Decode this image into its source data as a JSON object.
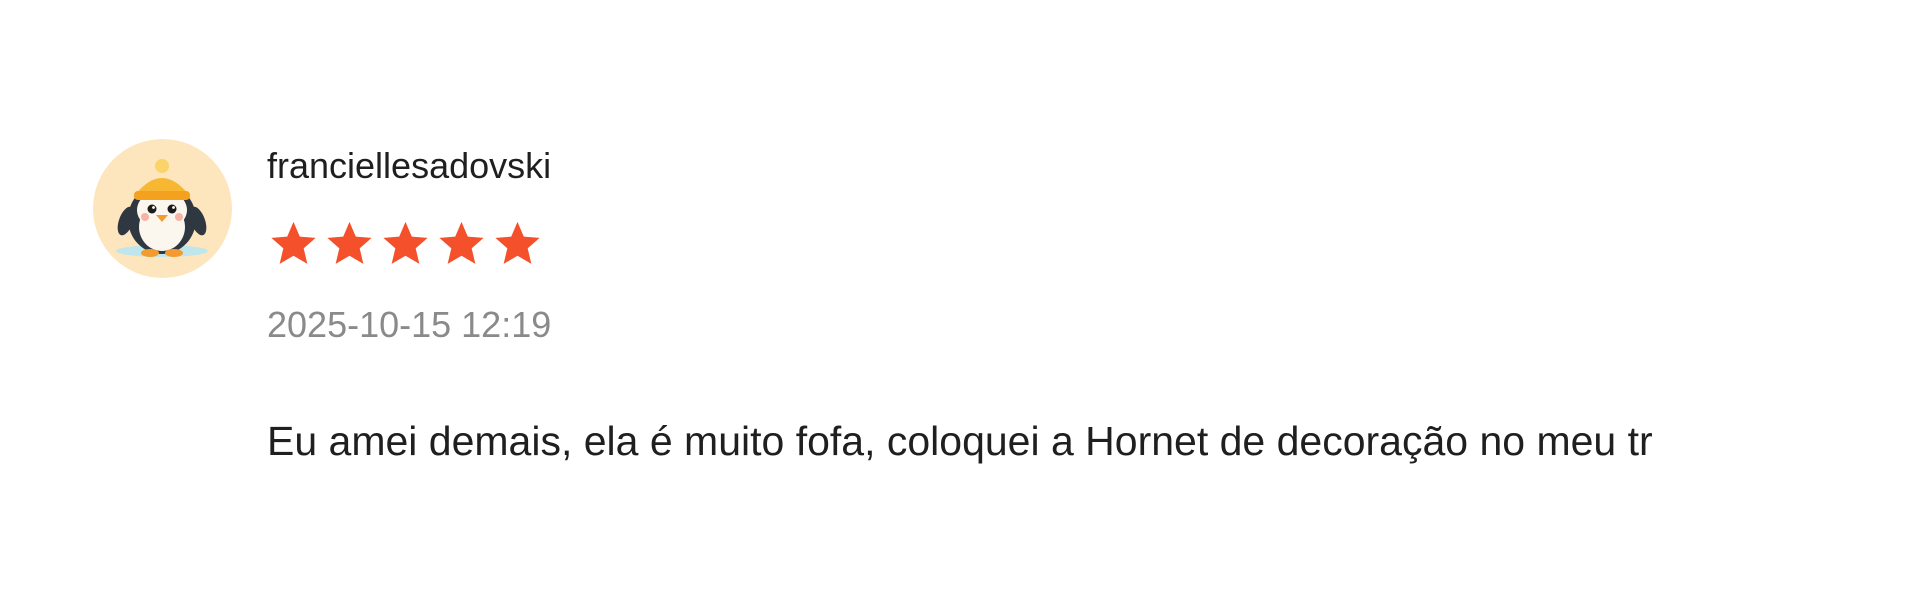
{
  "review": {
    "username": "franciellesadovski",
    "rating": 5,
    "rating_max": 5,
    "timestamp": "2025-10-15 12:19",
    "text": "Eu amei demais, ela é muito fofa, coloquei a Hornet  de decoração no meu tr",
    "avatar": {
      "icon": "penguin-with-yellow-hat-icon",
      "background": "#fde6bd"
    },
    "star_color": "#f4502c"
  }
}
